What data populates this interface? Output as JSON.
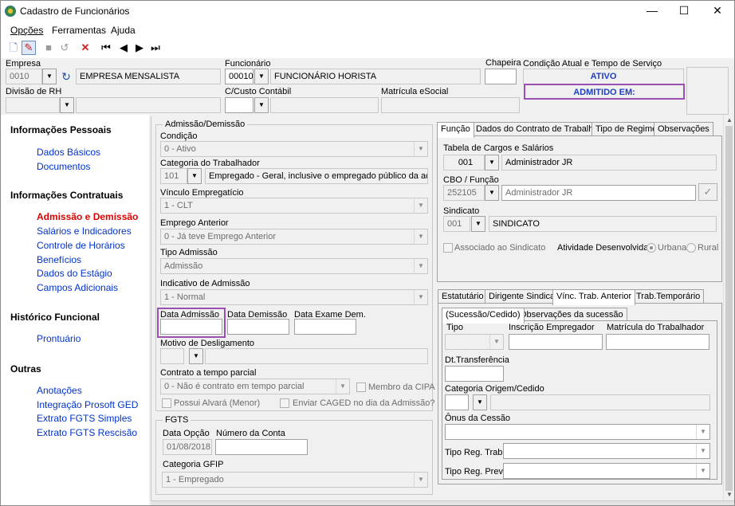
{
  "window": {
    "title": "Cadastro de Funcionários",
    "minimize": "—",
    "maximize": "☐",
    "close": "✕"
  },
  "menu": [
    "Opções",
    "Ferramentas",
    "Ajuda"
  ],
  "header": {
    "empresa_label": "Empresa",
    "empresa_code": "0010",
    "empresa_name": "EMPRESA MENSALISTA",
    "funcionario_label": "Funcionário",
    "funcionario_code": "00010",
    "funcionario_name": "FUNCIONÁRIO HORISTA",
    "chapeira_label": "Chapeira",
    "condicao_label": "Condição Atual e Tempo de Serviço",
    "condicao_status": "ATIVO",
    "admitido": "ADMITIDO EM:",
    "divisao_label": "Divisão de RH",
    "custo_label": "C/Custo Contábil",
    "matricula_label": "Matrícula eSocial"
  },
  "nav": {
    "pessoais": "Informações Pessoais",
    "dados_basicos": "Dados Básicos",
    "documentos": "Documentos",
    "contratuais": "Informações Contratuais",
    "admissao": "Admissão e Demissão",
    "salarios": "Salários e Indicadores",
    "horarios": "Controle de Horários",
    "beneficios": "Benefícios",
    "estagio": "Dados do Estágio",
    "adicionais": "Campos Adicionais",
    "historico": "Histórico Funcional",
    "prontuario": "Prontuário",
    "outras": "Outras",
    "anotacoes": "Anotações",
    "ged": "Integração Prosoft GED",
    "fgts_simples": "Extrato FGTS Simples",
    "fgts_rescisao": "Extrato FGTS Rescisão"
  },
  "admissao": {
    "group": "Admissão/Demissão",
    "condicao_label": "Condição",
    "condicao_value": "0 - Ativo",
    "categoria_label": "Categoria do Trabalhador",
    "categoria_code": "101",
    "categoria_desc": "Empregado - Geral, inclusive o empregado público da administ",
    "vinculo_label": "Vínculo Empregatício",
    "vinculo_value": "1 - CLT",
    "emprego_label": "Emprego Anterior",
    "emprego_value": "0 - Já teve Emprego Anterior",
    "tipo_label": "Tipo Admissão",
    "tipo_value": "Admissão",
    "indicativo_label": "Indicativo de Admissão",
    "indicativo_value": "1 - Normal",
    "data_adm_label": "Data Admissão",
    "data_dem_label": "Data Demissão",
    "data_exame_label": "Data Exame Dem.",
    "motivo_label": "Motivo de Desligamento",
    "parcial_label": "Contrato a tempo parcial",
    "parcial_value": "0 - Não é contrato em tempo parcial",
    "cipa_label": "Membro da CIPA",
    "alvara_label": "Possui Alvará (Menor)",
    "caged_label": "Enviar CAGED no dia da Admissão?"
  },
  "fgts": {
    "group": "FGTS",
    "data_opcao_label": "Data Opção",
    "data_opcao_value": "01/08/2018",
    "conta_label": "Número da Conta",
    "gfip_label": "Categoria GFIP",
    "gfip_value": "1 - Empregado"
  },
  "func_tabs": [
    "Função",
    "Dados do Contrato de Trabalho",
    "Tipo de Regime",
    "Observações"
  ],
  "funcao": {
    "tabela_label": "Tabela de Cargos e Salários",
    "tabela_code": "001",
    "tabela_name": "Administrador JR",
    "cbo_label": "CBO / Função",
    "cbo_code": "252105",
    "cbo_name": "Administrador JR",
    "sindicato_label": "Sindicato",
    "sindicato_code": "001",
    "sindicato_name": "SINDICATO",
    "associado_label": "Associado ao Sindicato",
    "atividade_label": "Atividade Desenvolvida:",
    "urbana": "Urbana",
    "rural": "Rural"
  },
  "lower_tabs": [
    "Estatutário",
    "Dirigente Sindical",
    "Vínc. Trab. Anterior",
    "Trab.Temporário"
  ],
  "sub_tabs": [
    "(Sucessão/Cedido)",
    "Observações da sucessão"
  ],
  "vinc": {
    "tipo_label": "Tipo",
    "inscricao_label": "Inscrição Empregador",
    "matricula_label": "Matrícula do Trabalhador",
    "dt_label": "Dt.Transferência",
    "categoria_label": "Categoria Origem/Cedido",
    "onus_label": "Ônus da Cessão",
    "reg_trab_label": "Tipo Reg. Trab.",
    "reg_prev_label": "Tipo Reg. Prev."
  }
}
